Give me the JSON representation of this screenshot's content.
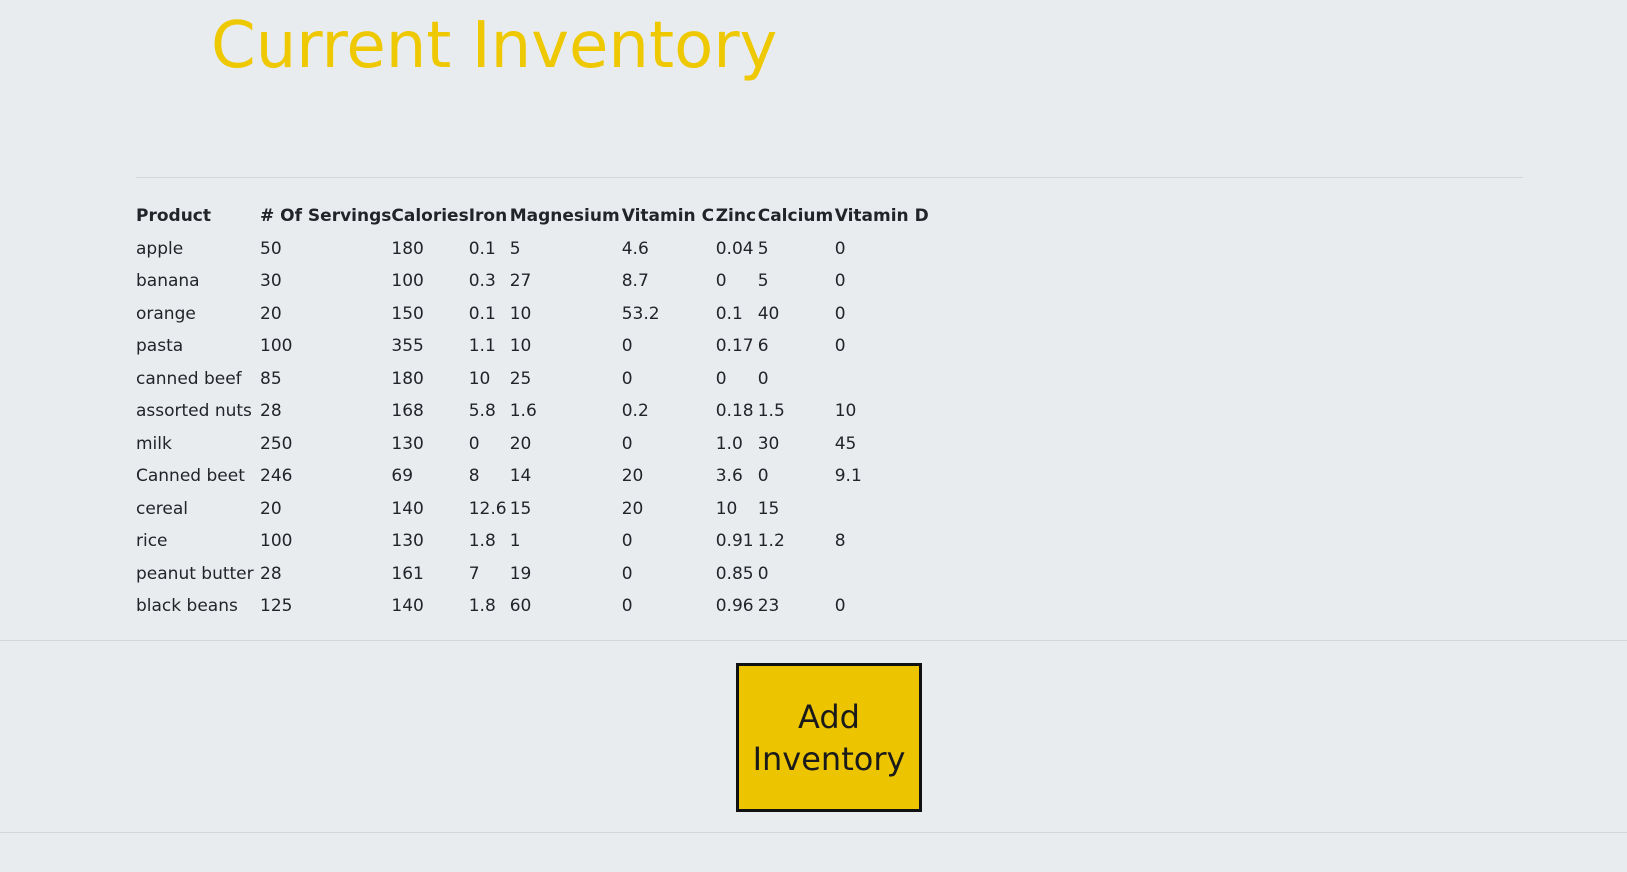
{
  "page": {
    "title": "Current Inventory",
    "accent_color": "#eec800",
    "button_color": "#ecc400"
  },
  "table": {
    "headers": [
      "Product",
      "# Of Servings",
      "Calories",
      "Iron",
      "Magnesium",
      "Vitamin C",
      "Zinc",
      "Calcium",
      "Vitamin D"
    ],
    "rows": [
      [
        "apple",
        "50",
        "180",
        "0.1",
        "5",
        "4.6",
        "0.04",
        "5",
        "0"
      ],
      [
        "banana",
        "30",
        "100",
        "0.3",
        "27",
        "8.7",
        "0",
        "5",
        "0"
      ],
      [
        "orange",
        "20",
        "150",
        "0.1",
        "10",
        "53.2",
        "0.1",
        "40",
        "0"
      ],
      [
        "pasta",
        "100",
        "355",
        "1.1",
        "10",
        "0",
        "0.17",
        "6",
        "0"
      ],
      [
        "canned beef",
        "85",
        "180",
        "10",
        "25",
        "0",
        "0",
        "0",
        ""
      ],
      [
        "assorted nuts",
        "28",
        "168",
        "5.8",
        "1.6",
        "0.2",
        "0.18",
        "1.5",
        "10"
      ],
      [
        "milk",
        "250",
        "130",
        "0",
        "20",
        "0",
        "1.0",
        "30",
        "45"
      ],
      [
        "Canned beet",
        "246",
        "69",
        "8",
        "14",
        "20",
        "3.6",
        "0",
        "9.1"
      ],
      [
        "cereal",
        "20",
        "140",
        "12.6",
        "15",
        "20",
        "10",
        "15",
        ""
      ],
      [
        "rice",
        "100",
        "130",
        "1.8",
        "1",
        "0",
        "0.91",
        "1.2",
        "8"
      ],
      [
        "peanut butter",
        "28",
        "161",
        "7",
        "19",
        "0",
        "0.85",
        "0",
        ""
      ],
      [
        "black beans",
        "125",
        "140",
        "1.8",
        "60",
        "0",
        "0.96",
        "23",
        "0"
      ]
    ]
  },
  "actions": {
    "add_inventory_label": "Add Inventory"
  }
}
